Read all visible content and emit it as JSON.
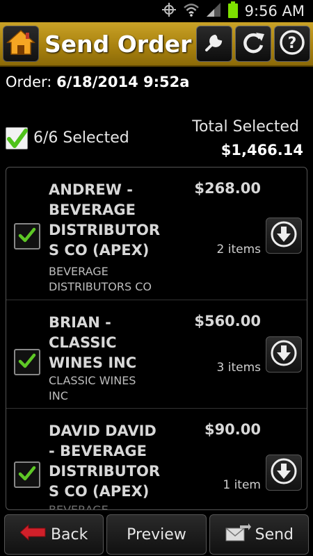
{
  "status_bar": {
    "time": "9:56 AM",
    "icons": [
      "gps-icon",
      "wifi-icon",
      "signal-icon",
      "battery-icon"
    ]
  },
  "header": {
    "title": "Send Order",
    "icons": [
      "home-icon",
      "wrench-icon",
      "refresh-icon",
      "help-icon"
    ]
  },
  "order": {
    "label": "Order:",
    "value": "6/18/2014 9:52a"
  },
  "selection": {
    "count_text": "6/6 Selected",
    "total_label": "Total Selected",
    "total_value": "$1,466.14",
    "all_checked": true
  },
  "items": [
    {
      "name_lines": [
        "ANDREW -",
        "BEVERAGE",
        "DISTRIBUTOR",
        "S CO (APEX)"
      ],
      "sub_lines": [
        "BEVERAGE",
        "DISTRIBUTORS CO"
      ],
      "amount": "$268.00",
      "count": "2 items",
      "checked": true
    },
    {
      "name_lines": [
        "BRIAN -",
        "CLASSIC",
        "WINES INC"
      ],
      "sub_lines": [
        "CLASSIC WINES",
        "INC"
      ],
      "amount": "$560.00",
      "count": "3 items",
      "checked": true
    },
    {
      "name_lines": [
        "DAVID DAVID",
        "- BEVERAGE",
        "DISTRIBUTOR",
        "S CO (APEX)"
      ],
      "sub_lines": [
        "BEVERAGE"
      ],
      "amount": "$90.00",
      "count": "1 item",
      "checked": true
    }
  ],
  "bottom": {
    "back": "Back",
    "preview": "Preview",
    "send": "Send"
  },
  "colors": {
    "header_gold": "#b8920f",
    "check_green": "#5ec826",
    "back_red": "#d0202a"
  }
}
